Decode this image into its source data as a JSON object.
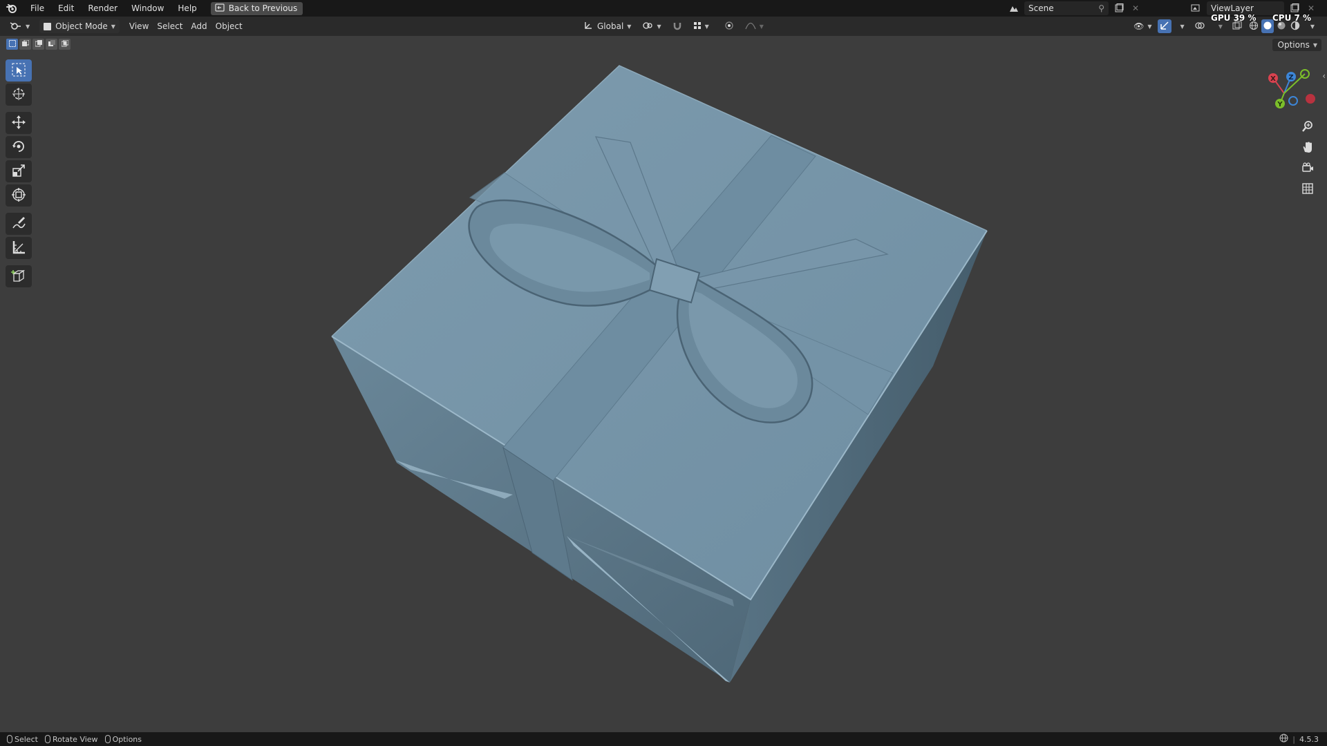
{
  "menu": {
    "items": [
      "File",
      "Edit",
      "Render",
      "Window",
      "Help"
    ],
    "back_button": "Back to Previous"
  },
  "scene": {
    "label": "Scene"
  },
  "view_layer": {
    "label": "ViewLayer"
  },
  "perf": {
    "gpu": "GPU 39 %",
    "cpu": "CPU 7 %"
  },
  "header": {
    "mode": "Object Mode",
    "view": "View",
    "select": "Select",
    "add": "Add",
    "object": "Object",
    "transform_orientation": "Global"
  },
  "viewport": {
    "options_label": "Options"
  },
  "gizmo": {
    "x": "X",
    "y": "Y",
    "z": "Z"
  },
  "status": {
    "select": "Select",
    "rotate_view": "Rotate View",
    "options": "Options",
    "version": "4.5.3"
  },
  "colors": {
    "accent": "#4772b3",
    "viewport_bg": "#3d3d3d",
    "box_top": "#7a98ab",
    "box_side": "#5f7b8d",
    "x_axis": "#d9424f",
    "y_axis": "#7cbf2a",
    "z_axis": "#3d86d8"
  }
}
